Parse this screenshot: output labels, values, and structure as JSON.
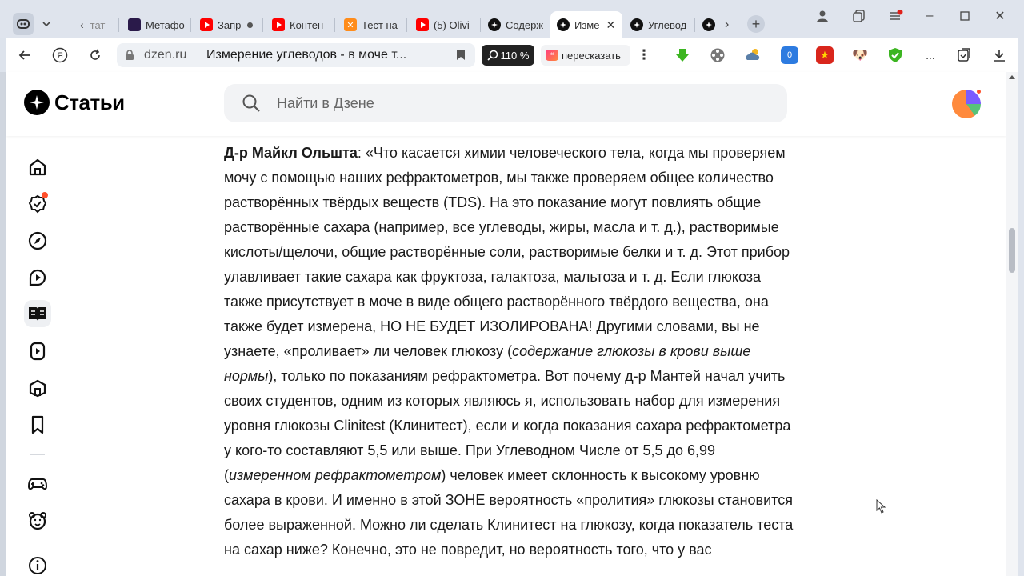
{
  "browser": {
    "tabs": [
      {
        "label": "тат",
        "icon": "arrow-left-icon"
      },
      {
        "label": "Метафо",
        "icon": "metaphor-favicon"
      },
      {
        "label": "Запр",
        "icon": "youtube-icon"
      },
      {
        "label": "Контен",
        "icon": "youtube-icon"
      },
      {
        "label": "Тест на",
        "icon": "test-favicon"
      },
      {
        "label": "(5) Olivi",
        "icon": "youtube-icon"
      },
      {
        "label": "Содерж",
        "icon": "dzen-icon"
      },
      {
        "label": "Изме",
        "icon": "dzen-icon",
        "active": true
      },
      {
        "label": "Углевод",
        "icon": "dzen-icon"
      }
    ],
    "domain": "dzen.ru",
    "page_title": "Измерение углеводов - в моче т...",
    "zoom": "110 %",
    "retell_label": "пересказать",
    "more_label": "..."
  },
  "site": {
    "logo_text": "Статьи",
    "search_placeholder": "Найти в Дзене"
  },
  "article": {
    "p1_bold": "Д-р Майкл Ольшта",
    "p1_a": ": «Что касается химии человеческого тела, когда мы проверяем мочу с помощью наших рефрактометров, мы также проверяем общее количество растворённых твёрдых веществ (TDS). На это показание могут повлиять общие растворённые сахара (например, все углеводы, жиры, масла и т. д.), растворимые кислоты/щелочи, общие растворённые соли, растворимые белки и т. д. Этот прибор улавливает такие сахара как фруктоза, галактоза, мальтоза и т. д. Если глюкоза также присутствует в моче в виде общего растворённого твёрдого вещества, она также будет измерена, НО НЕ БУДЕТ ИЗОЛИРОВАНА! Другими словами, вы не узнаете, «проливает» ли человек глюкозу (",
    "p1_i1": "содержание глюкозы в крови выше нормы",
    "p1_b": "), только по показаниям рефрактометра. Вот почему д-р Мантей начал учить своих студентов, одним из которых являюсь я, использовать набор для измерения уровня глюкозы Clinitest (Клинитест), если и когда показания сахара рефрактометра у кого-то составляют 5,5 или выше. При Углеводном Числе от 5,5 до 6,99 (",
    "p1_i2": "измеренном рефрактометром",
    "p1_c": ") человек имеет склонность к высокому уровню сахара в крови. И именно в этой ЗОНЕ вероятность «пролития» глюкозы становится более выраженной. Можно ли сделать Клинитест на глюкозу, когда показатель теста на сахар ниже? Конечно, это не повредит, но вероятность того, что у вас"
  },
  "colors": {
    "accent": "#ff4f2a",
    "youtube": "#ff0000",
    "search_bg": "#f2f3f5"
  }
}
